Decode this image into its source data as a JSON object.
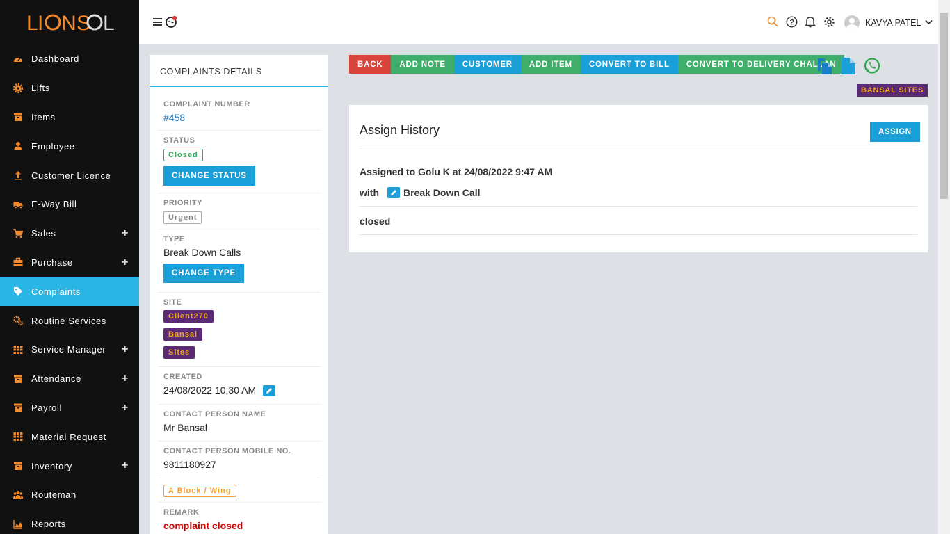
{
  "brand": {
    "logo_text": "LIONSOL"
  },
  "sidebar": {
    "items": [
      {
        "label": "Dashboard",
        "icon": "dashboard-icon",
        "plus": false
      },
      {
        "label": "Lifts",
        "icon": "gear-icon",
        "plus": false
      },
      {
        "label": "Items",
        "icon": "archive-icon",
        "plus": false
      },
      {
        "label": "Employee",
        "icon": "user-icon",
        "plus": false
      },
      {
        "label": "Customer Licence",
        "icon": "upload-icon",
        "plus": false
      },
      {
        "label": "E-Way Bill",
        "icon": "truck-icon",
        "plus": false
      },
      {
        "label": "Sales",
        "icon": "cart-icon",
        "plus": true
      },
      {
        "label": "Purchase",
        "icon": "briefcase-icon",
        "plus": true
      },
      {
        "label": "Complaints",
        "icon": "tag-icon",
        "plus": false,
        "active": true
      },
      {
        "label": "Routine Services",
        "icon": "gears-icon",
        "plus": false
      },
      {
        "label": "Service Manager",
        "icon": "grid-icon",
        "plus": true
      },
      {
        "label": "Attendance",
        "icon": "archive-icon",
        "plus": true
      },
      {
        "label": "Payroll",
        "icon": "archive-icon",
        "plus": true
      },
      {
        "label": "Material Request",
        "icon": "grid-icon",
        "plus": false
      },
      {
        "label": "Inventory",
        "icon": "archive-icon",
        "plus": true
      },
      {
        "label": "Routeman",
        "icon": "users-icon",
        "plus": false
      },
      {
        "label": "Reports",
        "icon": "chart-icon",
        "plus": false
      }
    ]
  },
  "topbar": {
    "user_name": "KAVYA PATEL"
  },
  "details": {
    "title": "COMPLAINTS DETAILS",
    "number_label": "COMPLAINT NUMBER",
    "number": "#458",
    "status_label": "STATUS",
    "status": "Closed",
    "change_status": "CHANGE STATUS",
    "priority_label": "PRIORITY",
    "priority": "Urgent",
    "type_label": "TYPE",
    "type": "Break Down Calls",
    "change_type": "CHANGE TYPE",
    "site_label": "SITE",
    "site_tags": [
      "Client270",
      "Bansal",
      "Sites"
    ],
    "created_label": "CREATED",
    "created": "24/08/2022 10:30 AM",
    "contact_label": "CONTACT PERSON NAME",
    "contact": "Mr Bansal",
    "mobile_label": "CONTACT PERSON MOBILE NO.",
    "mobile": "9811180927",
    "wing": "A Block / Wing",
    "remark_label": "REMARK",
    "remark": "complaint closed"
  },
  "actions": {
    "back": "BACK",
    "add_note": "ADD NOTE",
    "customer": "CUSTOMER",
    "add_item": "ADD ITEM",
    "convert_bill": "CONVERT TO BILL",
    "convert_challan": "CONVERT TO DELIVERY CHALLAN",
    "site_badge": "BANSAL SITES"
  },
  "history": {
    "title": "Assign History",
    "assign_button": "ASSIGN",
    "assigned_text": "Assigned to Golu K at 24/08/2022 9:47 AM",
    "with_label": "with",
    "call_type": "Break Down Call",
    "status_text": "closed"
  }
}
